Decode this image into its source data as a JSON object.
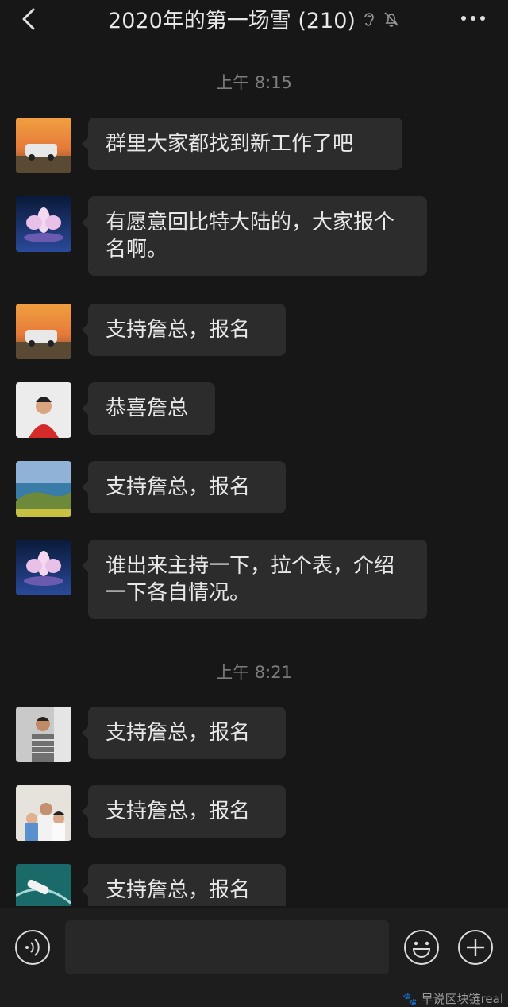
{
  "header": {
    "title": "2020年的第一场雪 (210)"
  },
  "timestamps": [
    "上午 8:15",
    "上午 8:21"
  ],
  "messages": [
    {
      "text": "群里大家都找到新工作了吧",
      "avatar": "car-sunset"
    },
    {
      "text": "有愿意回比特大陆的，大家报个名啊。",
      "avatar": "lotus"
    },
    {
      "text": "支持詹总，报名",
      "avatar": "car-sunset"
    },
    {
      "text": "恭喜詹总",
      "avatar": "woman-red"
    },
    {
      "text": "支持詹总，报名",
      "avatar": "coast"
    },
    {
      "text": "谁出来主持一下，拉个表，介绍一下各自情况。",
      "avatar": "lotus"
    },
    {
      "text": "支持詹总，报名",
      "avatar": "man-striped"
    },
    {
      "text": "支持詹总，报名",
      "avatar": "family"
    },
    {
      "text": "支持詹总，报名",
      "avatar": "sea-boat"
    }
  ],
  "input": {
    "placeholder": ""
  },
  "watermark": "🐾 早说区块链real",
  "colors": {
    "background": "#171717",
    "bubble": "#2c2c2c",
    "text": "#e8e8e8",
    "timestamp": "#7d7d7d"
  }
}
